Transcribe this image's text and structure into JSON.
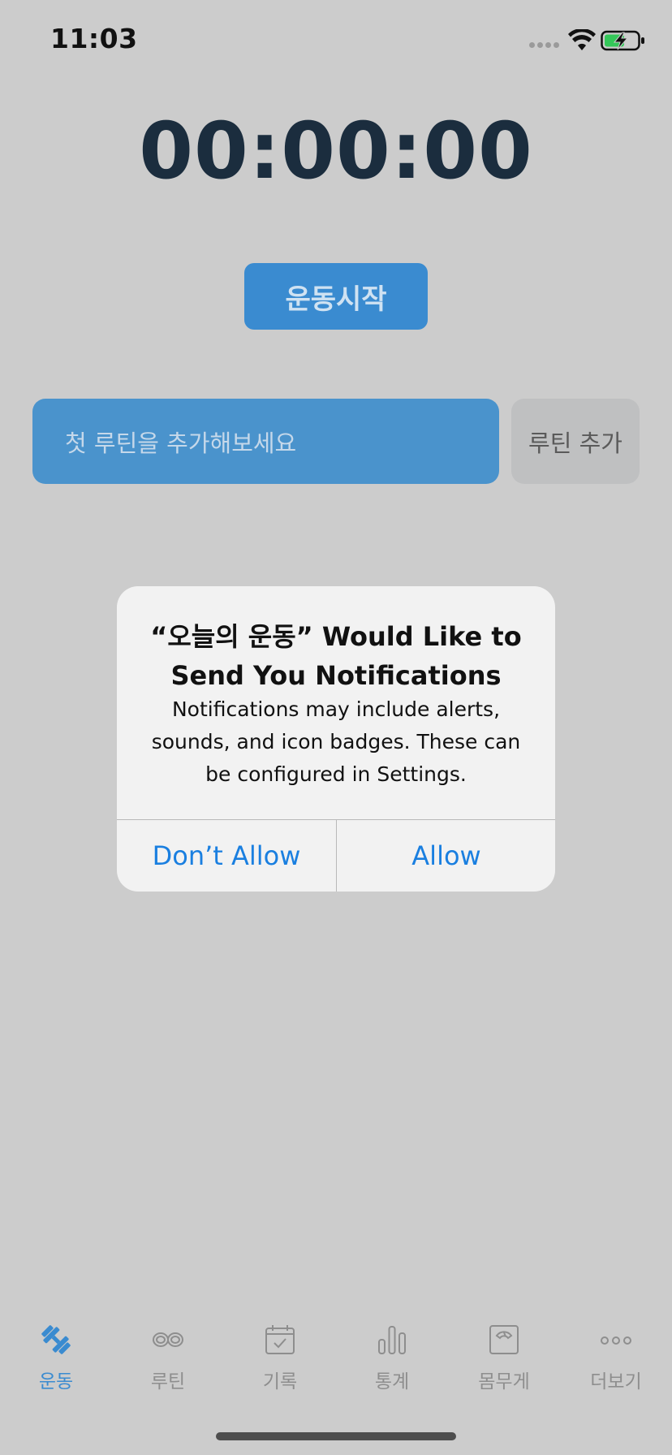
{
  "status_bar": {
    "time": "11:03"
  },
  "timer": {
    "display": "00:00:00"
  },
  "actions": {
    "start_label": "운동시작"
  },
  "routine": {
    "field_text": "첫 루틴을 추가해보세요",
    "add_label": "루틴 추가"
  },
  "alert": {
    "title_line1": "“오늘의 운동” Would Like to",
    "title_line2": "Send You Notifications",
    "message": "Notifications may include alerts, sounds, and icon badges. These can be configured in Settings.",
    "deny_label": "Don’t Allow",
    "allow_label": "Allow"
  },
  "tabs": [
    {
      "label": "운동",
      "icon": "dumbbell-icon",
      "active": true
    },
    {
      "label": "루틴",
      "icon": "infinity-icon",
      "active": false
    },
    {
      "label": "기록",
      "icon": "calendar-check-icon",
      "active": false
    },
    {
      "label": "통계",
      "icon": "bar-chart-icon",
      "active": false
    },
    {
      "label": "몸무게",
      "icon": "scale-icon",
      "active": false
    },
    {
      "label": "더보기",
      "icon": "more-icon",
      "active": false
    }
  ],
  "colors": {
    "background": "#cccccc",
    "accent": "#3a8bd0",
    "alert_button": "#1a7fe0",
    "inactive_tab": "#8e8e8e"
  }
}
